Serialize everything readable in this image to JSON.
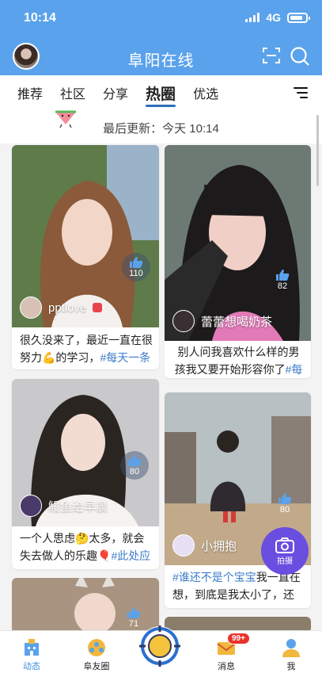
{
  "status": {
    "time": "10:14",
    "network": "4G"
  },
  "header": {
    "title": "阜阳在线"
  },
  "tabs": [
    {
      "label": "推荐",
      "active": false
    },
    {
      "label": "社区",
      "active": false
    },
    {
      "label": "分享",
      "active": false
    },
    {
      "label": "热圈",
      "active": true
    },
    {
      "label": "优选",
      "active": false
    }
  ],
  "feed": {
    "last_update": "最后更新：今天 10:14"
  },
  "cards": [
    {
      "author": "pptlove",
      "likes": "110",
      "desc": "很久没来了，最近一直在很努力💪的学习，",
      "tag": "#每天一条"
    },
    {
      "author": "蕾蕾想喝奶茶",
      "likes": "82",
      "desc": "别人问我喜欢什么样的男孩我又要开始形容你了",
      "tag": "#每"
    },
    {
      "author": "鳗鱼给早晨",
      "likes": "80",
      "desc": "一个人思虑🤔太多，就会失去做人的乐趣🎈",
      "tag": "#此处应"
    },
    {
      "author": "小拥抱",
      "likes": "80",
      "desc": "我一直在想，到底是我太小了，还",
      "tag": "#谁还不是个宝宝"
    },
    {
      "likes": "71"
    }
  ],
  "fab": {
    "label": "拍摄"
  },
  "nav": [
    {
      "label": "动态",
      "active": true
    },
    {
      "label": "阜友圈",
      "active": false
    },
    {
      "label": "",
      "active": false
    },
    {
      "label": "消息",
      "active": false,
      "badge": "99+"
    },
    {
      "label": "我",
      "active": false
    }
  ],
  "colors": {
    "header": "#5aa2ec",
    "accent": "#3d8ce0",
    "tag": "#3d7cc9",
    "fab": "#6a4ee0",
    "badge": "#e8332c"
  }
}
